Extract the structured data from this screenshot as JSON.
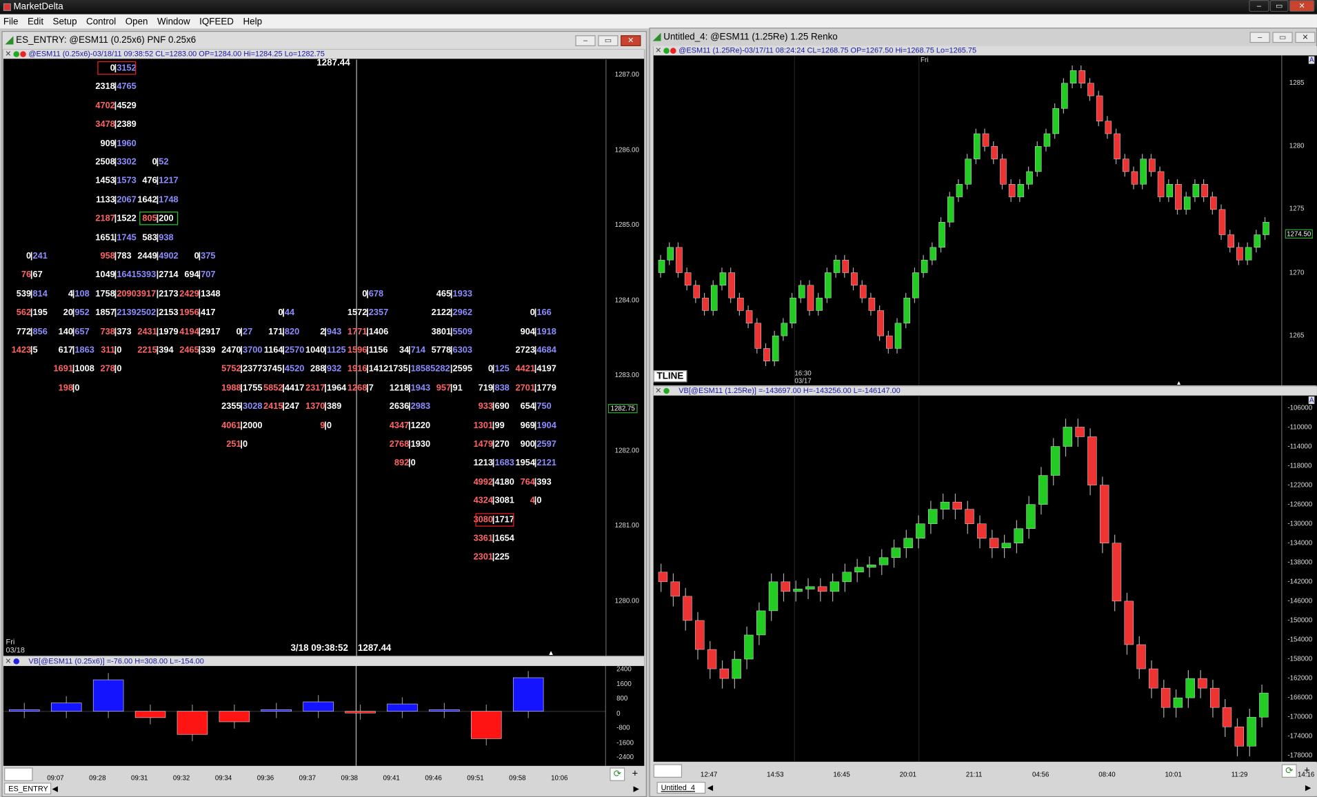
{
  "app": {
    "title": "MarketDelta",
    "window_controls": [
      "–",
      "▭",
      "✕"
    ]
  },
  "menu": [
    "File",
    "Edit",
    "Setup",
    "Control",
    "Open",
    "Window",
    "IQFEED",
    "Help"
  ],
  "left_window": {
    "title": "ES_ENTRY: @ESM11 (0.25x6) PNF 0.25x6",
    "info": "@ESM11 (0.25x6)-03/18/11 09:38:52 CL=1283.00 OP=1284.00 Hi=1284.25 Lo=1282.75",
    "top_price": "1287.44",
    "bottom_label": "3/18 09:38:52",
    "bottom_price": "1287.44",
    "day_label": "Fri",
    "date_label": "03/18",
    "price_axis": [
      "1287.00",
      "1286.00",
      "1285.00",
      "1284.00",
      "1283.00",
      "1282.00",
      "1281.00",
      "1280.00"
    ],
    "current_price": "1282.75",
    "cells": [
      {
        "c": 0,
        "r": 0,
        "a": "0",
        "b": "3152",
        "ac": "w",
        "bc": "bl",
        "box": "red"
      },
      {
        "c": 0,
        "r": 1,
        "a": "2318",
        "b": "4765",
        "ac": "w",
        "bc": "bl"
      },
      {
        "c": 0,
        "r": 2,
        "a": "4702",
        "b": "4529",
        "ac": "rd",
        "bc": "w"
      },
      {
        "c": 0,
        "r": 3,
        "a": "3478",
        "b": "2389",
        "ac": "rd",
        "bc": "w"
      },
      {
        "c": 0,
        "r": 4,
        "a": "909",
        "b": "1960",
        "ac": "w",
        "bc": "bl"
      },
      {
        "c": 0,
        "r": 5,
        "a": "2508",
        "b": "3302",
        "ac": "w",
        "bc": "bl"
      },
      {
        "c": 1,
        "r": 5,
        "a": "0",
        "b": "52",
        "ac": "w",
        "bc": "bl"
      },
      {
        "c": 0,
        "r": 6,
        "a": "1453",
        "b": "1573",
        "ac": "w",
        "bc": "bl"
      },
      {
        "c": 1,
        "r": 6,
        "a": "476",
        "b": "1217",
        "ac": "w",
        "bc": "bl"
      },
      {
        "c": 0,
        "r": 7,
        "a": "1133",
        "b": "2067",
        "ac": "w",
        "bc": "bl"
      },
      {
        "c": 1,
        "r": 7,
        "a": "1642",
        "b": "1748",
        "ac": "w",
        "bc": "bl"
      },
      {
        "c": 0,
        "r": 8,
        "a": "2187",
        "b": "1522",
        "ac": "rd",
        "bc": "w"
      },
      {
        "c": 1,
        "r": 8,
        "a": "805",
        "b": "200",
        "ac": "rd",
        "bc": "w",
        "box": "green"
      },
      {
        "c": 0,
        "r": 9,
        "a": "1651",
        "b": "1745",
        "ac": "w",
        "bc": "bl"
      },
      {
        "c": 1,
        "r": 9,
        "a": "583",
        "b": "938",
        "ac": "w",
        "bc": "bl"
      },
      {
        "c": -2,
        "r": 10,
        "a": "0",
        "b": "241",
        "ac": "w",
        "bc": "bl"
      },
      {
        "c": 0,
        "r": 10,
        "a": "958",
        "b": "783",
        "ac": "rd",
        "bc": "w"
      },
      {
        "c": 1,
        "r": 10,
        "a": "2449",
        "b": "4902",
        "ac": "w",
        "bc": "bl"
      },
      {
        "c": 2,
        "r": 10,
        "a": "0",
        "b": "375",
        "ac": "w",
        "bc": "bl"
      },
      {
        "c": -2,
        "r": 11,
        "a": "76",
        "b": "67",
        "ac": "rd",
        "bc": "w"
      },
      {
        "c": 0,
        "r": 11,
        "a": "1049",
        "b": "16415393",
        "ac": "w",
        "bc": "bl"
      },
      {
        "c": 1,
        "r": 11,
        "a": "",
        "b": "2714",
        "ac": "w",
        "bc": "w"
      },
      {
        "c": 2,
        "r": 11,
        "a": "694",
        "b": "707",
        "ac": "w",
        "bc": "bl"
      },
      {
        "c": -2,
        "r": 12,
        "a": "539",
        "b": "814",
        "ac": "w",
        "bc": "bl"
      },
      {
        "c": -1,
        "r": 12,
        "a": "4",
        "b": "108",
        "ac": "w",
        "bc": "bl"
      },
      {
        "c": 0,
        "r": 12,
        "a": "1758",
        "b": "20903917",
        "ac": "w",
        "bc": "rd"
      },
      {
        "c": 1,
        "r": 12,
        "a": "",
        "b": "2173",
        "ac": "w",
        "bc": "w"
      },
      {
        "c": 2,
        "r": 12,
        "a": "2429",
        "b": "1348",
        "ac": "rd",
        "bc": "w"
      },
      {
        "c": 6,
        "r": 12,
        "a": "0",
        "b": "678",
        "ac": "w",
        "bc": "bl"
      },
      {
        "c": 8,
        "r": 12,
        "a": "465",
        "b": "1933",
        "ac": "w",
        "bc": "bl"
      },
      {
        "c": -2,
        "r": 13,
        "a": "562",
        "b": "195",
        "ac": "rd",
        "bc": "w"
      },
      {
        "c": -1,
        "r": 13,
        "a": "20",
        "b": "952",
        "ac": "w",
        "bc": "bl"
      },
      {
        "c": 0,
        "r": 13,
        "a": "1857",
        "b": "21392502",
        "ac": "w",
        "bc": "bl"
      },
      {
        "c": 1,
        "r": 13,
        "a": "",
        "b": "2153",
        "ac": "w",
        "bc": "w"
      },
      {
        "c": 2,
        "r": 13,
        "a": "1956",
        "b": "417",
        "ac": "rd",
        "bc": "w"
      },
      {
        "c": 4,
        "r": 13,
        "a": "0",
        "b": "44",
        "ac": "w",
        "bc": "bl"
      },
      {
        "c": 6,
        "r": 13,
        "a": "1572",
        "b": "2357",
        "ac": "w",
        "bc": "bl"
      },
      {
        "c": 8,
        "r": 13,
        "a": "2122",
        "b": "2962",
        "ac": "w",
        "bc": "bl"
      },
      {
        "c": 10,
        "r": 13,
        "a": "0",
        "b": "166",
        "ac": "w",
        "bc": "bl"
      },
      {
        "c": -2,
        "r": 14,
        "a": "772",
        "b": "856",
        "ac": "w",
        "bc": "bl"
      },
      {
        "c": -1,
        "r": 14,
        "a": "140",
        "b": "657",
        "ac": "w",
        "bc": "bl"
      },
      {
        "c": 0,
        "r": 14,
        "a": "738",
        "b": "373",
        "ac": "rd",
        "bc": "w"
      },
      {
        "c": 1,
        "r": 14,
        "a": "2431",
        "b": "1979",
        "ac": "rd",
        "bc": "w"
      },
      {
        "c": 2,
        "r": 14,
        "a": "4194",
        "b": "2917",
        "ac": "rd",
        "bc": "w"
      },
      {
        "c": 3,
        "r": 14,
        "a": "0",
        "b": "27",
        "ac": "w",
        "bc": "bl"
      },
      {
        "c": 4,
        "r": 14,
        "a": "171",
        "b": "820",
        "ac": "w",
        "bc": "bl"
      },
      {
        "c": 5,
        "r": 14,
        "a": "2",
        "b": "943",
        "ac": "w",
        "bc": "bl"
      },
      {
        "c": 6,
        "r": 14,
        "a": "1771",
        "b": "1406",
        "ac": "rd",
        "bc": "w"
      },
      {
        "c": 8,
        "r": 14,
        "a": "3801",
        "b": "5509",
        "ac": "w",
        "bc": "bl"
      },
      {
        "c": 10,
        "r": 14,
        "a": "904",
        "b": "1918",
        "ac": "w",
        "bc": "bl"
      },
      {
        "c": -2,
        "r": 15,
        "a": "1423",
        "b": "5",
        "ac": "rd",
        "bc": "w"
      },
      {
        "c": -1,
        "r": 15,
        "a": "617",
        "b": "1863",
        "ac": "w",
        "bc": "bl"
      },
      {
        "c": 0,
        "r": 15,
        "a": "311",
        "b": "0",
        "ac": "rd",
        "bc": "w"
      },
      {
        "c": 1,
        "r": 15,
        "a": "2215",
        "b": "394",
        "ac": "rd",
        "bc": "w"
      },
      {
        "c": 2,
        "r": 15,
        "a": "2465",
        "b": "339",
        "ac": "rd",
        "bc": "w"
      },
      {
        "c": 3,
        "r": 15,
        "a": "2470",
        "b": "3700",
        "ac": "w",
        "bc": "bl"
      },
      {
        "c": 4,
        "r": 15,
        "a": "1164",
        "b": "2570",
        "ac": "w",
        "bc": "bl"
      },
      {
        "c": 5,
        "r": 15,
        "a": "1040",
        "b": "1125",
        "ac": "w",
        "bc": "bl"
      },
      {
        "c": 6,
        "r": 15,
        "a": "1596",
        "b": "1156",
        "ac": "rd",
        "bc": "w"
      },
      {
        "c": 7,
        "r": 15,
        "a": "34",
        "b": "714",
        "ac": "w",
        "bc": "bl"
      },
      {
        "c": 8,
        "r": 15,
        "a": "5778",
        "b": "6303",
        "ac": "w",
        "bc": "bl"
      },
      {
        "c": 10,
        "r": 15,
        "a": "2723",
        "b": "4684",
        "ac": "w",
        "bc": "bl"
      },
      {
        "c": -1,
        "r": 16,
        "a": "1691",
        "b": "1008",
        "ac": "rd",
        "bc": "w"
      },
      {
        "c": 0,
        "r": 16,
        "a": "278",
        "b": "0",
        "ac": "rd",
        "bc": "w"
      },
      {
        "c": 3,
        "r": 16,
        "a": "5752",
        "b": "23773745",
        "ac": "rd",
        "bc": "w"
      },
      {
        "c": 4,
        "r": 16,
        "a": "",
        "b": "4520",
        "ac": "w",
        "bc": "bl"
      },
      {
        "c": 5,
        "r": 16,
        "a": "288",
        "b": "932",
        "ac": "w",
        "bc": "bl"
      },
      {
        "c": 6,
        "r": 16,
        "a": "1916",
        "b": "14121735",
        "ac": "rd",
        "bc": "w"
      },
      {
        "c": 7,
        "r": 16,
        "a": "",
        "b": "18585282",
        "ac": "w",
        "bc": "bl"
      },
      {
        "c": 8,
        "r": 16,
        "a": "",
        "b": "2595",
        "ac": "w",
        "bc": "w"
      },
      {
        "c": 9,
        "r": 16,
        "a": "0",
        "b": "125",
        "ac": "w",
        "bc": "bl"
      },
      {
        "c": 10,
        "r": 16,
        "a": "4421",
        "b": "4197",
        "ac": "rd",
        "bc": "w"
      },
      {
        "c": -1,
        "r": 17,
        "a": "198",
        "b": "0",
        "ac": "rd",
        "bc": "w"
      },
      {
        "c": 3,
        "r": 17,
        "a": "1988",
        "b": "1755",
        "ac": "rd",
        "bc": "w"
      },
      {
        "c": 4,
        "r": 17,
        "a": "5852",
        "b": "4417",
        "ac": "rd",
        "bc": "w"
      },
      {
        "c": 5,
        "r": 17,
        "a": "2317",
        "b": "1964",
        "ac": "rd",
        "bc": "w"
      },
      {
        "c": 6,
        "r": 17,
        "a": "1268",
        "b": "7",
        "ac": "rd",
        "bc": "w"
      },
      {
        "c": 7,
        "r": 17,
        "a": "1218",
        "b": "1943",
        "ac": "w",
        "bc": "bl"
      },
      {
        "c": 8,
        "r": 17,
        "a": "957",
        "b": "91",
        "ac": "rd",
        "bc": "w"
      },
      {
        "c": 9,
        "r": 17,
        "a": "719",
        "b": "838",
        "ac": "w",
        "bc": "bl"
      },
      {
        "c": 10,
        "r": 17,
        "a": "2701",
        "b": "1779",
        "ac": "rd",
        "bc": "w"
      },
      {
        "c": 3,
        "r": 18,
        "a": "2355",
        "b": "3028",
        "ac": "w",
        "bc": "bl"
      },
      {
        "c": 4,
        "r": 18,
        "a": "2415",
        "b": "247",
        "ac": "rd",
        "bc": "w"
      },
      {
        "c": 5,
        "r": 18,
        "a": "1370",
        "b": "389",
        "ac": "rd",
        "bc": "w"
      },
      {
        "c": 7,
        "r": 18,
        "a": "2636",
        "b": "2983",
        "ac": "w",
        "bc": "bl"
      },
      {
        "c": 9,
        "r": 18,
        "a": "933",
        "b": "690",
        "ac": "rd",
        "bc": "w"
      },
      {
        "c": 10,
        "r": 18,
        "a": "654",
        "b": "750",
        "ac": "w",
        "bc": "bl"
      },
      {
        "c": 3,
        "r": 19,
        "a": "4061",
        "b": "2000",
        "ac": "rd",
        "bc": "w"
      },
      {
        "c": 5,
        "r": 19,
        "a": "9",
        "b": "0",
        "ac": "rd",
        "bc": "w"
      },
      {
        "c": 7,
        "r": 19,
        "a": "4347",
        "b": "1220",
        "ac": "rd",
        "bc": "w"
      },
      {
        "c": 9,
        "r": 19,
        "a": "1301",
        "b": "99",
        "ac": "rd",
        "bc": "w"
      },
      {
        "c": 10,
        "r": 19,
        "a": "969",
        "b": "1904",
        "ac": "w",
        "bc": "bl"
      },
      {
        "c": 3,
        "r": 20,
        "a": "251",
        "b": "0",
        "ac": "rd",
        "bc": "w"
      },
      {
        "c": 7,
        "r": 20,
        "a": "2768",
        "b": "1930",
        "ac": "rd",
        "bc": "w"
      },
      {
        "c": 9,
        "r": 20,
        "a": "1479",
        "b": "270",
        "ac": "rd",
        "bc": "w"
      },
      {
        "c": 10,
        "r": 20,
        "a": "900",
        "b": "2597",
        "ac": "w",
        "bc": "bl"
      },
      {
        "c": 7,
        "r": 21,
        "a": "892",
        "b": "0",
        "ac": "rd",
        "bc": "w"
      },
      {
        "c": 9,
        "r": 21,
        "a": "1213",
        "b": "1683",
        "ac": "w",
        "bc": "bl"
      },
      {
        "c": 10,
        "r": 21,
        "a": "1954",
        "b": "2121",
        "ac": "w",
        "bc": "bl"
      },
      {
        "c": 9,
        "r": 22,
        "a": "4992",
        "b": "4180",
        "ac": "rd",
        "bc": "w"
      },
      {
        "c": 10,
        "r": 22,
        "a": "764",
        "b": "393",
        "ac": "rd",
        "bc": "w"
      },
      {
        "c": 9,
        "r": 23,
        "a": "4324",
        "b": "3081",
        "ac": "rd",
        "bc": "w"
      },
      {
        "c": 10,
        "r": 23,
        "a": "4",
        "b": "0",
        "ac": "rd",
        "bc": "w"
      },
      {
        "c": 9,
        "r": 24,
        "a": "3080",
        "b": "1717",
        "ac": "rd",
        "bc": "w",
        "box": "red"
      },
      {
        "c": 9,
        "r": 25,
        "a": "3361",
        "b": "1654",
        "ac": "rd",
        "bc": "w"
      },
      {
        "c": 9,
        "r": 26,
        "a": "2301",
        "b": "225",
        "ac": "rd",
        "bc": "w"
      }
    ],
    "vb_info": "VB[@ESM11 (0.25x6)] =-76.00 H=308.00 L=-154.00",
    "vb_axis": [
      "2400",
      "1600",
      "800",
      "0",
      "-800",
      "-1600",
      "-2400"
    ],
    "vb_values": [
      40,
      400,
      1500,
      -300,
      -1100,
      -500,
      60,
      450,
      -10,
      350,
      20,
      -1300,
      1600
    ],
    "times": [
      "09:07",
      "09:28",
      "09:31",
      "09:32",
      "09:34",
      "09:36",
      "09:37",
      "09:38",
      "09:41",
      "09:46",
      "09:51",
      "09:58",
      "10:06"
    ],
    "tab": "ES_ENTRY",
    "plus": "+"
  },
  "right_window": {
    "title": "Untitled_4: @ESM11 (1.25Re) 1.25 Renko",
    "info": "@ESM11 (1.25Re)-03/17/11 08:24:24 CL=1268.75 OP=1267.50 Hi=1268.75 Lo=1265.75",
    "day_label": "Fri",
    "time_label": "16:30",
    "date_label": "03/17",
    "price_axis": [
      "1285",
      "1280",
      "1275",
      "1270",
      "1265"
    ],
    "current_price": "1274.50",
    "tline": "TLINE",
    "vb_info": "VB[@ESM11 (1.25Re)] =-143697.00 H=-143256.00 L=-146147.00",
    "vb_axis": [
      "-106000",
      "-110000",
      "-114000",
      "-118000",
      "-122000",
      "-126000",
      "-130000",
      "-134000",
      "-138000",
      "-142000",
      "-146000",
      "-150000",
      "-154000",
      "-158000",
      "-162000",
      "-166000",
      "-170000",
      "-174000",
      "-178000"
    ],
    "times": [
      "12:47",
      "14:53",
      "16:45",
      "20:01",
      "21:11",
      "04:56",
      "08:40",
      "10:01",
      "11:29",
      "14:16"
    ],
    "tab": "Untitled_4",
    "plus": "+",
    "axis_marker": "A"
  },
  "chart_data": [
    {
      "type": "line",
      "title": "@ESM11 (1.25Re) 1.25 Renko",
      "y": [
        1271,
        1272,
        1270,
        1269,
        1268,
        1267,
        1269,
        1270,
        1268,
        1267,
        1266,
        1264,
        1263,
        1265,
        1266,
        1268,
        1269,
        1267,
        1268,
        1270,
        1271,
        1270,
        1269,
        1268,
        1267,
        1265,
        1264,
        1266,
        1268,
        1270,
        1271,
        1272,
        1274,
        1276,
        1277,
        1279,
        1281,
        1280,
        1279,
        1277,
        1276,
        1277,
        1278,
        1280,
        1281,
        1283,
        1285,
        1286,
        1285,
        1284,
        1282,
        1281,
        1279,
        1278,
        1277,
        1279,
        1278,
        1276,
        1277,
        1275,
        1276,
        1277,
        1276,
        1275,
        1273,
        1272,
        1271,
        1272,
        1273,
        1274
      ],
      "ylim": [
        1262,
        1287
      ],
      "ylabel": ""
    },
    {
      "type": "line",
      "title": "VB[@ESM11 (1.25Re)]",
      "y": [
        -142000,
        -145000,
        -150000,
        -156000,
        -160000,
        -162000,
        -158000,
        -153000,
        -148000,
        -142000,
        -144000,
        -143500,
        -143000,
        -144000,
        -142000,
        -140000,
        -139000,
        -138500,
        -137000,
        -135000,
        -133000,
        -130000,
        -127000,
        -125500,
        -127000,
        -130000,
        -133000,
        -135000,
        -134000,
        -131000,
        -126000,
        -120000,
        -114000,
        -110000,
        -112000,
        -122000,
        -134000,
        -146000,
        -155000,
        -160000,
        -164000,
        -168000,
        -166000,
        -162000,
        -164000,
        -168000,
        -172000,
        -176000,
        -170000,
        -165000
      ],
      "ylim": [
        -178000,
        -104000
      ],
      "ylabel": ""
    }
  ]
}
